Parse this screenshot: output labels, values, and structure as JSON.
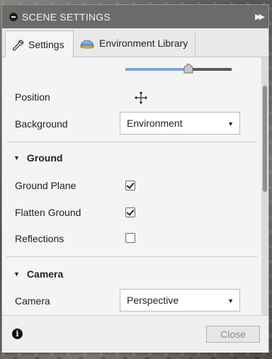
{
  "panel": {
    "title": "SCENE SETTINGS",
    "tabs": [
      {
        "label": "Settings",
        "icon": "wrench-icon",
        "active": true
      },
      {
        "label": "Environment Library",
        "icon": "dome-icon",
        "active": false
      }
    ]
  },
  "slider": {
    "value_fraction": 0.59
  },
  "rows": {
    "position_label": "Position",
    "background_label": "Background",
    "background_value": "Environment",
    "ground_section": "Ground",
    "ground_plane_label": "Ground Plane",
    "ground_plane_checked": true,
    "flatten_ground_label": "Flatten Ground",
    "flatten_ground_checked": true,
    "reflections_label": "Reflections",
    "reflections_checked": false,
    "camera_section": "Camera",
    "camera_label": "Camera",
    "camera_value": "Perspective"
  },
  "footer": {
    "close_label": "Close",
    "info_glyph": "i"
  },
  "colors": {
    "titlebar": "#6b6b6b",
    "slider_fill": "#7ea3d6",
    "panel_bg": "#efefef"
  }
}
